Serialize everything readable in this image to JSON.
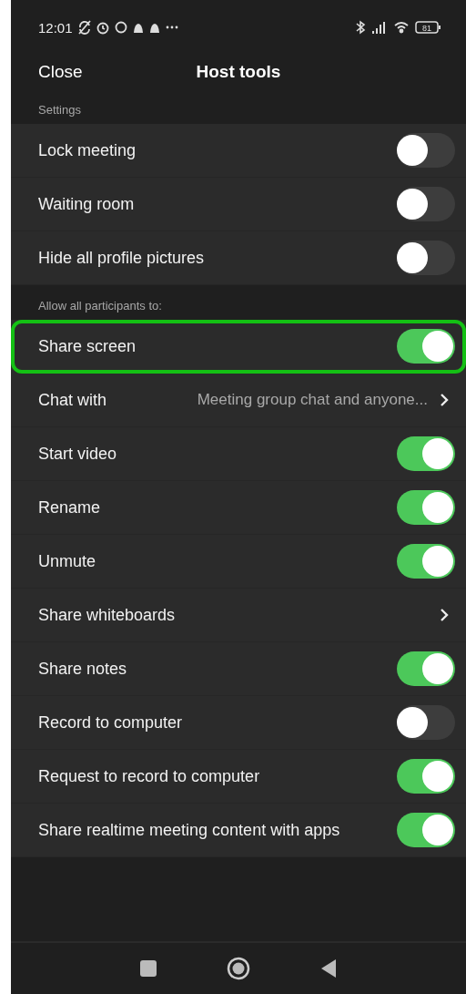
{
  "status_bar": {
    "time": "12:01",
    "battery": "81"
  },
  "header": {
    "close": "Close",
    "title": "Host tools"
  },
  "sections": [
    {
      "title": "Settings",
      "items": [
        {
          "kind": "toggle",
          "label": "Lock meeting",
          "on": false,
          "highlighted": false
        },
        {
          "kind": "toggle",
          "label": "Waiting room",
          "on": false,
          "highlighted": false
        },
        {
          "kind": "toggle",
          "label": "Hide all profile pictures",
          "on": false,
          "highlighted": false
        }
      ]
    },
    {
      "title": "Allow all participants to:",
      "items": [
        {
          "kind": "toggle",
          "label": "Share screen",
          "on": true,
          "highlighted": true
        },
        {
          "kind": "link",
          "label": "Chat with",
          "value": "Meeting group chat and anyone...",
          "highlighted": false
        },
        {
          "kind": "toggle",
          "label": "Start video",
          "on": true,
          "highlighted": false
        },
        {
          "kind": "toggle",
          "label": "Rename",
          "on": true,
          "highlighted": false
        },
        {
          "kind": "toggle",
          "label": "Unmute",
          "on": true,
          "highlighted": false
        },
        {
          "kind": "link",
          "label": "Share whiteboards",
          "highlighted": false
        },
        {
          "kind": "toggle",
          "label": "Share notes",
          "on": true,
          "highlighted": false
        },
        {
          "kind": "toggle",
          "label": "Record to computer",
          "on": false,
          "highlighted": false
        },
        {
          "kind": "toggle",
          "label": "Request to record to computer",
          "on": true,
          "highlighted": false
        },
        {
          "kind": "toggle",
          "label": "Share realtime meeting content with apps",
          "on": true,
          "highlighted": false
        }
      ]
    }
  ]
}
